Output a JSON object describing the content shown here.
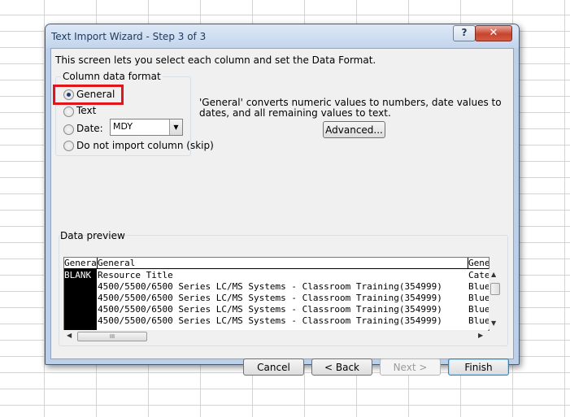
{
  "window": {
    "title": "Text Import Wizard - Step 3 of 3",
    "help_label": "?",
    "close_label": "✕"
  },
  "intro_text": "This screen lets you select each column and set the Data Format.",
  "column_format": {
    "legend": "Column data format",
    "options": [
      {
        "label": "General",
        "checked": true
      },
      {
        "label": "Text",
        "checked": false
      },
      {
        "label": "Date:",
        "checked": false
      },
      {
        "label": "Do not import column (skip)",
        "checked": false
      }
    ],
    "date_format_value": "MDY"
  },
  "description": "'General' converts numeric values to numbers, date values to dates, and all remaining values to text.",
  "advanced_button": "Advanced...",
  "preview": {
    "label": "Data preview",
    "headers": [
      "General",
      "General",
      "Gene"
    ],
    "rows": [
      [
        "BLANK",
        "Resource Title",
        "Cate"
      ],
      [
        "",
        "4500/5500/6500 Series LC/MS Systems - Classroom Training(354999)",
        "Blue"
      ],
      [
        "",
        "4500/5500/6500 Series LC/MS Systems - Classroom Training(354999)",
        "Blue"
      ],
      [
        "",
        "4500/5500/6500 Series LC/MS Systems - Classroom Training(354999)",
        "Blue"
      ],
      [
        "",
        "4500/5500/6500 Series LC/MS Systems - Classroom Training(354999)",
        "Blue"
      ]
    ],
    "hscroll_grip": "III"
  },
  "buttons": {
    "cancel": "Cancel",
    "back": "< Back",
    "next": "Next >",
    "finish": "Finish"
  },
  "colors": {
    "highlight": "#e0161a",
    "title_text": "#1e395b"
  }
}
